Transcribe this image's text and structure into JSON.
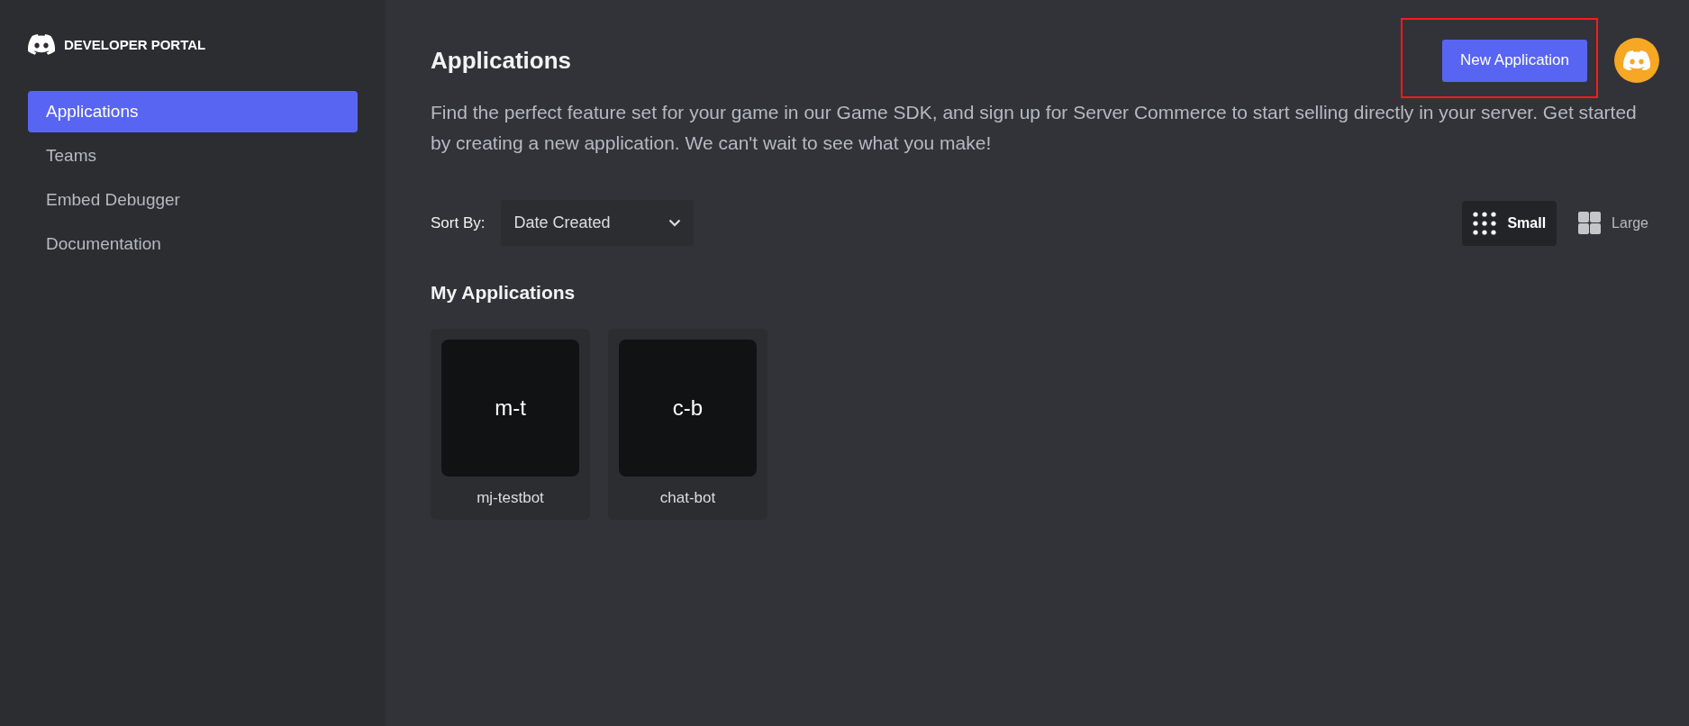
{
  "brand": {
    "title": "DEVELOPER PORTAL"
  },
  "sidebar": {
    "items": [
      {
        "label": "Applications",
        "selected": true
      },
      {
        "label": "Teams",
        "selected": false
      },
      {
        "label": "Embed Debugger",
        "selected": false
      },
      {
        "label": "Documentation",
        "selected": false
      }
    ]
  },
  "header": {
    "title": "Applications",
    "new_button": {
      "label": "New Application",
      "highlighted": true
    }
  },
  "description": "Find the perfect feature set for your game in our Game SDK, and sign up for Server Commerce to start selling directly in your server. Get started by creating a new application. We can't wait to see what you make!",
  "sort": {
    "label": "Sort By:",
    "value": "Date Created"
  },
  "view_toggle": [
    {
      "kind": "small",
      "label": "Small",
      "selected": true
    },
    {
      "kind": "large",
      "label": "Large",
      "selected": false
    }
  ],
  "section_title": "My Applications",
  "applications": [
    {
      "initials": "m-t",
      "name": "mj-testbot"
    },
    {
      "initials": "c-b",
      "name": "chat-bot"
    }
  ]
}
